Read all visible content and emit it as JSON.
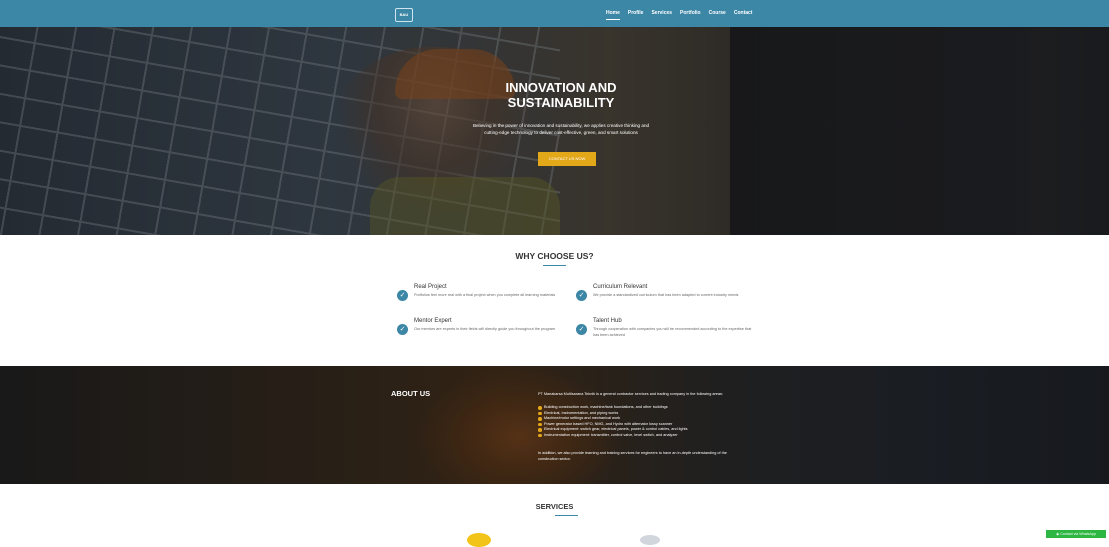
{
  "nav": {
    "logo_text": "BAU",
    "links": [
      {
        "label": "Home",
        "active": true
      },
      {
        "label": "Profile"
      },
      {
        "label": "Services"
      },
      {
        "label": "Portfolio"
      },
      {
        "label": "Course"
      },
      {
        "label": "Contact"
      }
    ]
  },
  "hero": {
    "title_line1": "INNOVATION AND",
    "title_line2": "SUSTAINABILITY",
    "subtitle": "Believing in the power of innovation and sustainability, we applies creative thinking and cutting-edge technology to deliver cost-effective, green, and smart solutions",
    "cta_label": "CONTACT US NOW"
  },
  "why": {
    "title": "WHY CHOOSE US?",
    "features": [
      {
        "title": "Real Project",
        "desc": "Portfolios feel more real with a final project when you complete all learning materials"
      },
      {
        "title": "Curriculum Relevant",
        "desc": "We provide a standardized curriculum that has been adapted to current industry needs"
      },
      {
        "title": "Mentor Expert",
        "desc": "Our mentors are experts in their fields will directly guide you throughout the program"
      },
      {
        "title": "Talent Hub",
        "desc": "Through cooperation with companies you will be recommended according to the expertise that has been achieved"
      }
    ]
  },
  "about": {
    "title": "ABOUT US",
    "intro": "PT Manakarsa Multisarana Teknik is a general contractor services and trading company in the following areas:",
    "items": [
      "Building construction work, machine/tank foundations, and other buildings",
      "Electrical, Instrumentation, and piping works",
      "Machine/motor settings and mechanical work",
      "Power generator based HFO, NMG, and Hydro with alternator lossy scanner",
      "Electrical equipment: switch gear, electrical panels, power & control cables, and lights",
      "Instrumentation equipment: transmitter, control valve, level switch, and analyzer"
    ],
    "outro": "In addition, we also provide learning and training services for engineers to have an in-depth understanding of the construction sector."
  },
  "services": {
    "title": "SERVICES"
  },
  "whatsapp": {
    "label": "Contact via WhatsApp"
  },
  "colors": {
    "nav_bg": "#3c86a6",
    "accent_yellow": "#e3a71a",
    "whatsapp_green": "#2db742"
  },
  "icons": [
    "check-circle-icon",
    "whatsapp-icon"
  ]
}
